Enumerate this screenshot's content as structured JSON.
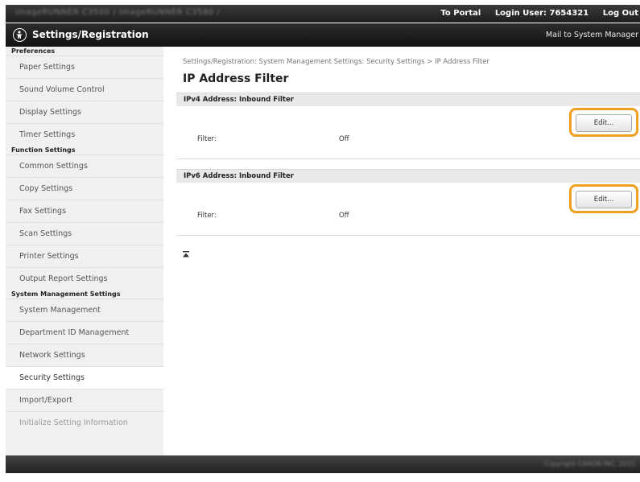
{
  "header": {
    "address_blurred": "imageRUNNER   C3500 / imageRUNNER C3580 /",
    "to_portal": "To Portal",
    "login_user": "Login User: 7654321",
    "log_out": "Log Out"
  },
  "titlebar": {
    "title": "Settings/Registration",
    "mail_to": "Mail to System Manager"
  },
  "sidebar": {
    "sections": [
      {
        "label": "Preferences",
        "items": [
          {
            "label": "Paper Settings"
          },
          {
            "label": "Sound Volume Control"
          },
          {
            "label": "Display Settings"
          },
          {
            "label": "Timer Settings"
          }
        ]
      },
      {
        "label": "Function Settings",
        "items": [
          {
            "label": "Common Settings"
          },
          {
            "label": "Copy Settings"
          },
          {
            "label": "Fax Settings"
          },
          {
            "label": "Scan Settings"
          },
          {
            "label": "Printer Settings"
          },
          {
            "label": "Output Report Settings"
          }
        ]
      },
      {
        "label": "System Management Settings",
        "items": [
          {
            "label": "System Management"
          },
          {
            "label": "Department ID Management"
          },
          {
            "label": "Network Settings"
          },
          {
            "label": "Security Settings",
            "active": true
          },
          {
            "label": "Import/Export"
          },
          {
            "label": "Initialize Setting Information",
            "dim": true
          }
        ]
      }
    ]
  },
  "main": {
    "breadcrumb": "Settings/Registration: System Management Settings: Security Settings > IP Address Filter",
    "page_title": "IP Address Filter",
    "sections": [
      {
        "heading": "IPv4 Address: Inbound Filter",
        "edit_label": "Edit...",
        "filter_label": "Filter:",
        "filter_value": "Off"
      },
      {
        "heading": "IPv6 Address: Inbound Filter",
        "edit_label": "Edit...",
        "filter_label": "Filter:",
        "filter_value": "Off"
      }
    ]
  },
  "footer": {
    "copyright_blurred": "Copyright CANON INC. 2015"
  },
  "colors": {
    "highlight": "#f0a020",
    "header_bg": "#1e1e1e",
    "sidebar_bg": "#f0f0f0"
  }
}
